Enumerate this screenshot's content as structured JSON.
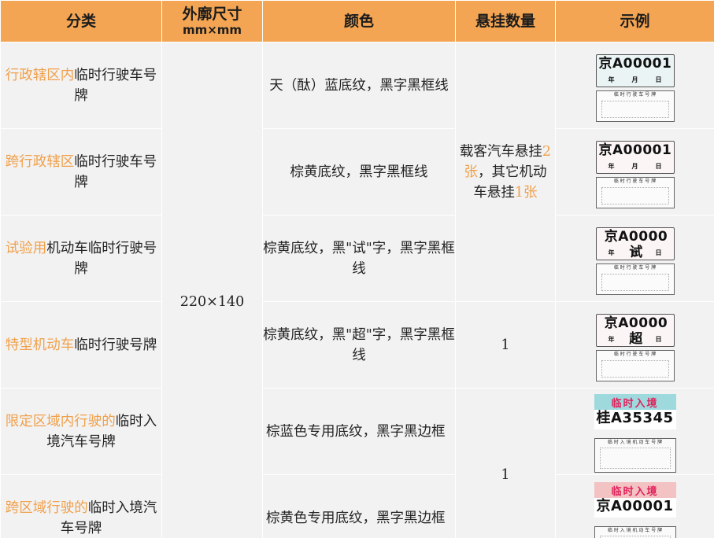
{
  "header": {
    "category": "分类",
    "size_line1": "外廓尺寸",
    "size_line2": "mm×mm",
    "color": "颜色",
    "hang": "悬挂数量",
    "example": "示例"
  },
  "size_value": "220×140",
  "rows": [
    {
      "cat_hl": "行政辖区内",
      "cat_rest": "临时行驶车号牌",
      "color": "天（酞）蓝底纹，黑字黑框线"
    },
    {
      "cat_hl": "跨行政辖区",
      "cat_rest": "临时行驶车号牌",
      "color": "棕黄底纹，黑字黑框线"
    },
    {
      "cat_hl": "试验用",
      "cat_rest": "机动车临时行驶号牌",
      "color": "棕黄底纹，黑\"试\"字，黑字黑框线"
    },
    {
      "cat_hl": "特型机动车",
      "cat_rest": "临时行驶号牌",
      "color": "棕黄底纹，黑\"超\"字，黑字黑框线"
    },
    {
      "cat_hl": "限定区域内行驶的",
      "cat_rest": "临时入境汽车号牌",
      "color": "棕蓝色专用底纹，黑字黑边框"
    },
    {
      "cat_hl": "跨区域行驶的",
      "cat_rest": "临时入境汽车号牌",
      "color": "棕黄色专用底纹，黑字黑边框"
    }
  ],
  "hang": {
    "main_p1": "载客汽车悬挂",
    "main_hl1": "2张",
    "main_p2": "，其它机动车悬挂",
    "main_hl2": "1张",
    "special": "1",
    "entry": "1"
  },
  "examples": {
    "plate1": "京A00001",
    "plate2": "京A00001",
    "plate3": "京A0000试",
    "plate4": "京A0000超",
    "plate5": "桂A35345",
    "plate6": "京A00001",
    "year": "年",
    "month": "月",
    "day": "日",
    "back_title": "临 时 行 驶 车 号 牌",
    "entry_title": "临时入境",
    "entry_back_title": "临 时 入 境 机 动 车 号 牌"
  },
  "colors": {
    "header_bg": "#f3a553",
    "cell_bg": "#f2f2f2",
    "highlight": "#f0a04b"
  }
}
